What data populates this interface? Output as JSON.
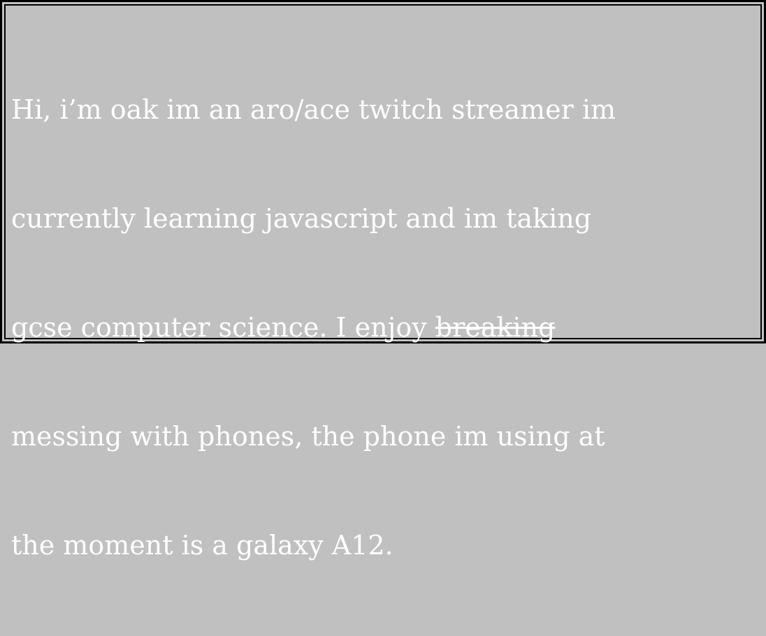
{
  "bio": {
    "line1": "Hi, i’m oak im an aro/ace twitch streamer im",
    "line2": "currently learning javascript and im taking",
    "line3_before": "gcse computer science. I enjoy ",
    "line3_struck": "breaking",
    "line4": "messing with phones, the phone im using at",
    "line5": "the moment is a galaxy A12."
  },
  "colors": {
    "background": "#c0c0c0",
    "text": "#ffffff",
    "border": "#000000"
  }
}
